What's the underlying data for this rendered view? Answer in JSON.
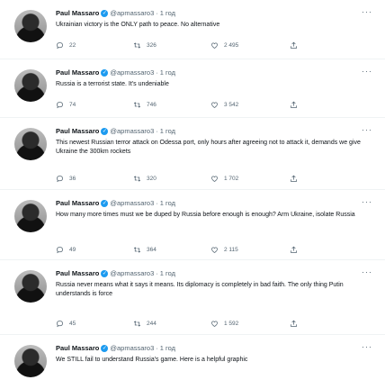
{
  "author": {
    "name": "Paul Massaro",
    "handle": "@apmassaro3",
    "dot": "·"
  },
  "tweets": [
    {
      "time": "1 год",
      "text": "Ukrainian victory is the ONLY path to peace. No alternative",
      "replies": "22",
      "retweets": "326",
      "likes": "2 495"
    },
    {
      "time": "1 год",
      "text": "Russia is a terrorist state. It's undeniable",
      "replies": "74",
      "retweets": "746",
      "likes": "3 542"
    },
    {
      "time": "1 год",
      "text": "This newest Russian terror attack on Odessa port, only hours after agreeing not to attack it, demands we give Ukraine the 300km rockets",
      "replies": "36",
      "retweets": "320",
      "likes": "1 702"
    },
    {
      "time": "1 год",
      "text": "How many more times must we be duped by Russia before enough is enough? Arm Ukraine, isolate Russia",
      "replies": "49",
      "retweets": "364",
      "likes": "2 115"
    },
    {
      "time": "1 год",
      "text": "Russia never means what it says it means. Its diplomacy is completely in bad faith. The only thing Putin understands is force",
      "replies": "45",
      "retweets": "244",
      "likes": "1 592"
    },
    {
      "time": "1 год",
      "text": "We STILL fail to understand Russia's game. Here is a helpful graphic"
    }
  ]
}
